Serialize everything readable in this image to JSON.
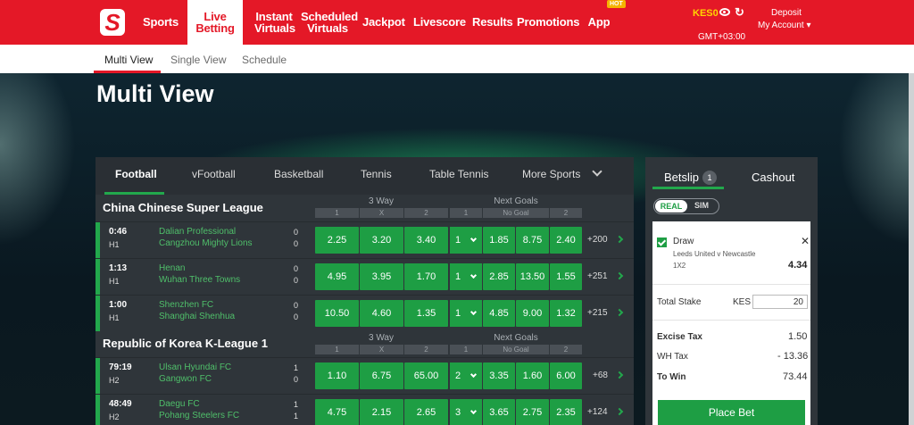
{
  "header": {
    "logo": "S",
    "nav": [
      {
        "label": "Sports"
      },
      {
        "label": "Live\nBetting"
      },
      {
        "label": "Instant\nVirtuals"
      },
      {
        "label": "Scheduled\nVirtuals"
      },
      {
        "label": "Jackpot"
      },
      {
        "label": "Livescore"
      },
      {
        "label": "Results"
      },
      {
        "label": "Promotions"
      },
      {
        "label": "App"
      }
    ],
    "hot_badge": "HOT",
    "balance": "KES0",
    "timezone": "GMT+03:00",
    "deposit": "Deposit",
    "account": "My Account ▾"
  },
  "subnav": {
    "items": [
      "Multi View",
      "Single View",
      "Schedule"
    ]
  },
  "page_title": "Multi View",
  "sport_tabs": [
    "Football",
    "vFootball",
    "Basketball",
    "Tennis",
    "Table Tennis",
    "More Sports"
  ],
  "markets": {
    "three_way": "3 Way",
    "next_goals": "Next Goals",
    "three_way_cols": [
      "1",
      "X",
      "2"
    ],
    "next_goals_cols": [
      "1",
      "No Goal",
      "2"
    ]
  },
  "leagues": [
    {
      "name": "China Chinese Super League",
      "matches": [
        {
          "time": "0:46",
          "half": "H1",
          "home": "Dalian Professional",
          "away": "Cangzhou Mighty Lions",
          "home_score": "0",
          "away_score": "0",
          "odds": [
            "2.25",
            "3.20",
            "3.40"
          ],
          "goal_select": "1",
          "next_goal_odds": [
            "1.85",
            "8.75",
            "2.40"
          ],
          "more": "+200"
        },
        {
          "time": "1:13",
          "half": "H1",
          "home": "Henan",
          "away": "Wuhan Three Towns",
          "home_score": "0",
          "away_score": "0",
          "odds": [
            "4.95",
            "3.95",
            "1.70"
          ],
          "goal_select": "1",
          "next_goal_odds": [
            "2.85",
            "13.50",
            "1.55"
          ],
          "more": "+251"
        },
        {
          "time": "1:00",
          "half": "H1",
          "home": "Shenzhen FC",
          "away": "Shanghai Shenhua",
          "home_score": "0",
          "away_score": "0",
          "odds": [
            "10.50",
            "4.60",
            "1.35"
          ],
          "goal_select": "1",
          "next_goal_odds": [
            "4.85",
            "9.00",
            "1.32"
          ],
          "more": "+215"
        }
      ]
    },
    {
      "name": "Republic of Korea K-League 1",
      "matches": [
        {
          "time": "79:19",
          "half": "H2",
          "home": "Ulsan Hyundai FC",
          "away": "Gangwon FC",
          "home_score": "1",
          "away_score": "0",
          "odds": [
            "1.10",
            "6.75",
            "65.00"
          ],
          "goal_select": "2",
          "next_goal_odds": [
            "3.35",
            "1.60",
            "6.00"
          ],
          "more": "+68"
        },
        {
          "time": "48:49",
          "half": "H2",
          "home": "Daegu FC",
          "away": "Pohang Steelers FC",
          "home_score": "1",
          "away_score": "1",
          "odds": [
            "4.75",
            "2.15",
            "2.65"
          ],
          "goal_select": "3",
          "next_goal_odds": [
            "3.65",
            "2.75",
            "2.35"
          ],
          "more": "+124"
        }
      ]
    }
  ],
  "betslip": {
    "tab_betslip": "Betslip",
    "count": "1",
    "tab_cashout": "Cashout",
    "mode_real": "REAL",
    "mode_sim": "SIM",
    "selection": {
      "pick": "Draw",
      "match": "Leeds United v Newcastle",
      "market": "1X2",
      "odds": "4.34"
    },
    "total_stake_label": "Total Stake",
    "currency": "KES",
    "stake": "20",
    "excise_tax_label": "Excise Tax",
    "excise_tax": "1.50",
    "wh_tax_label": "WH Tax",
    "wh_tax": "- 13.36",
    "to_win_label": "To Win",
    "to_win": "73.44",
    "place_bet": "Place Bet"
  },
  "colors": {
    "brand_red": "#e41827",
    "odds_green": "#1e9e44",
    "panel": "#2f353a"
  }
}
